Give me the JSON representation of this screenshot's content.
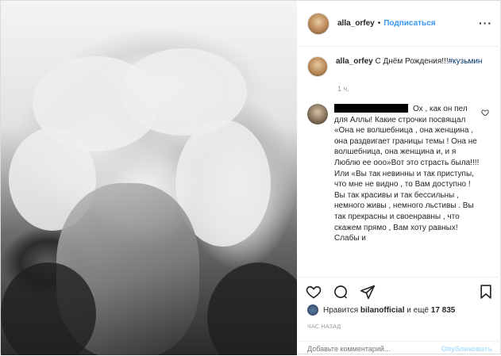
{
  "header": {
    "username": "alla_orfey",
    "separator": "•",
    "follow_label": "Подписаться",
    "more_icon": "more-icon"
  },
  "caption": {
    "username": "alla_orfey",
    "text": "С Днём Рождения!!!",
    "hashtag": "#кузьмин",
    "time": "1 ч."
  },
  "comment": {
    "text": "Ох , как он пел для Аллы! Какие строчки посвящал «Она не волшебница , она женщина , она раздвигает границы темы ! Она не волшебница, она женщина и, и я Люблю ее ооо»Вот это страсть была!!!! Или «Вы так невинны и так приступы, что мне не видно , то Вам доступно ! Вы так красивы и так бессильны , немного живы , немного льстивы . Вы так прекрасны и своенравны , что скажем прямо , Вам хоту равных! Слабы и"
  },
  "likes": {
    "prefix": "Нравится",
    "user": "bilanofficial",
    "middle": "и ещё",
    "count": "17 835"
  },
  "post_time": "ЧАС НАЗАД",
  "add_comment": {
    "placeholder": "Добавьте комментарий...",
    "publish_label": "Опубликовать"
  }
}
